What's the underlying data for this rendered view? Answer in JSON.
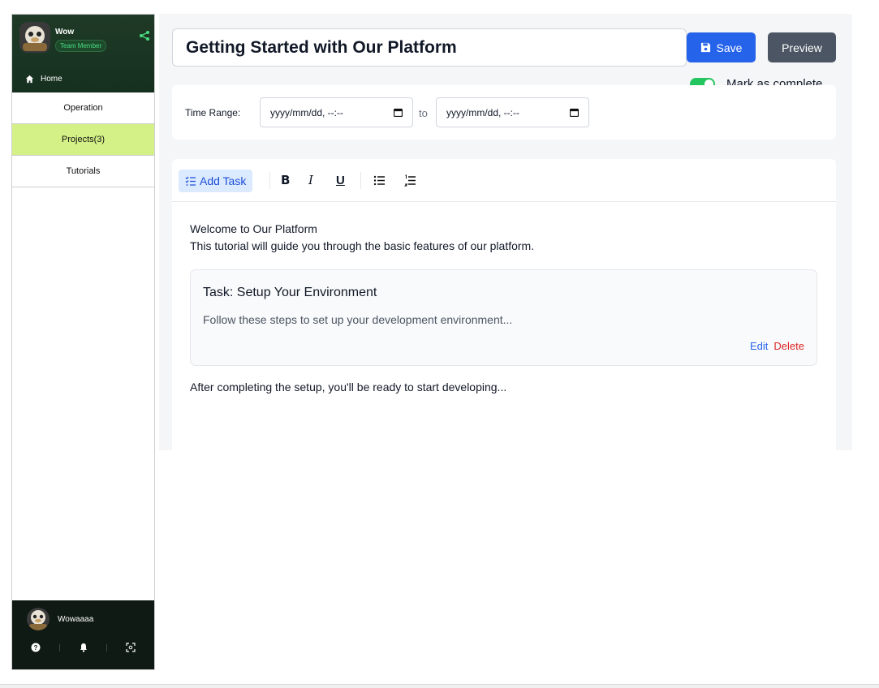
{
  "sidebar": {
    "user_name": "Wow",
    "user_role": "Team Member",
    "home_label": "Home",
    "items": [
      {
        "label": "Operation",
        "active": false
      },
      {
        "label": "Projects(3)",
        "active": true
      },
      {
        "label": "Tutorials",
        "active": false
      }
    ],
    "footer_user": "Wowaaaa",
    "footer_icons": [
      "help-icon",
      "bell-icon",
      "scan-icon"
    ],
    "colors": {
      "header_bg": "#1f3a26",
      "active_item_bg": "#d4f187",
      "footer_bg": "#0f1a14"
    }
  },
  "editor": {
    "title_value": "Getting Started with Our Platform",
    "save_label": "Save",
    "preview_label": "Preview",
    "complete_label": "Mark as complete",
    "complete_on": true,
    "time_range_label": "Time Range:",
    "start_placeholder": "yyyy/mm/dd, --:--",
    "to_label": "to",
    "end_placeholder": "yyyy/mm/dd, --:--",
    "toolbar": {
      "add_task_label": "Add Task",
      "bold_label": "B",
      "italic_label": "I",
      "underline_label": "U"
    },
    "content": {
      "heading_line": "Welcome to Our Platform",
      "intro_line": "This tutorial will guide you through the basic features of our platform.",
      "task": {
        "title": "Task: Setup Your Environment",
        "description": "Follow these steps to set up your development environment...",
        "edit_label": "Edit",
        "delete_label": "Delete"
      },
      "after_line": "After completing the setup, you'll be ready to start developing..."
    },
    "colors": {
      "save": "#2563eb",
      "preview": "#4b5563",
      "toggle": "#22c55e",
      "add_task_bg": "#dbeafe",
      "delete": "#dc2626"
    }
  }
}
